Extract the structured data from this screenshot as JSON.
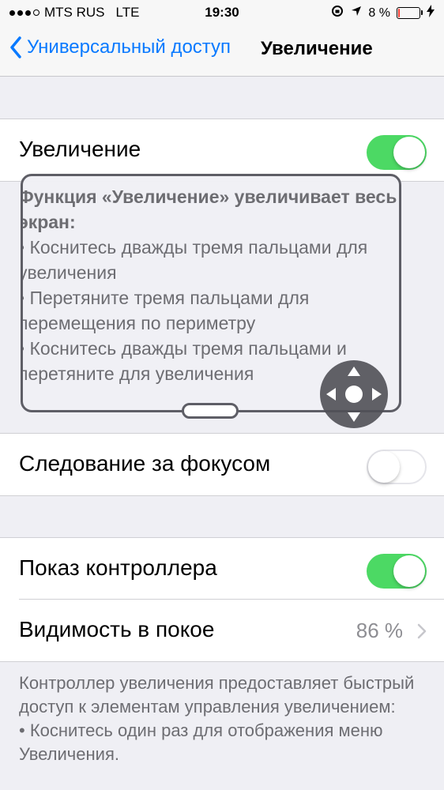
{
  "status_bar": {
    "carrier": "MTS RUS",
    "network": "LTE",
    "time": "19:30",
    "battery_percent": "8 %",
    "battery_level": 0.08
  },
  "nav": {
    "back_label": "Универсальный доступ",
    "title": "Увеличение"
  },
  "zoom_group": {
    "toggle_label": "Увеличение",
    "toggle_on": true
  },
  "lens_description": {
    "lead": "Функция «Увеличение» увеличивает весь экран:",
    "bullets": [
      "•  Коснитесь дважды тремя пальцами для увеличения",
      "•  Перетяните тремя пальцами для перемещения по периметру",
      "•  Коснитесь дважды тремя пальцами и перетяните для увеличения"
    ]
  },
  "focus_row": {
    "label": "Следование за фокусом",
    "toggle_on": false
  },
  "controller_group": {
    "show_label": "Показ контроллера",
    "show_on": true,
    "idle_label": "Видимость в покое",
    "idle_value": "86 %"
  },
  "controller_footer": {
    "line1": "Контроллер увеличения предоставляет быстрый доступ к элементам управления увеличением:",
    "line2": "• Коснитесь один раз для отображения меню Увеличения."
  },
  "colors": {
    "accent": "#0a7aff",
    "toggle_on": "#4cd964",
    "battery_low": "#ff3b30"
  }
}
